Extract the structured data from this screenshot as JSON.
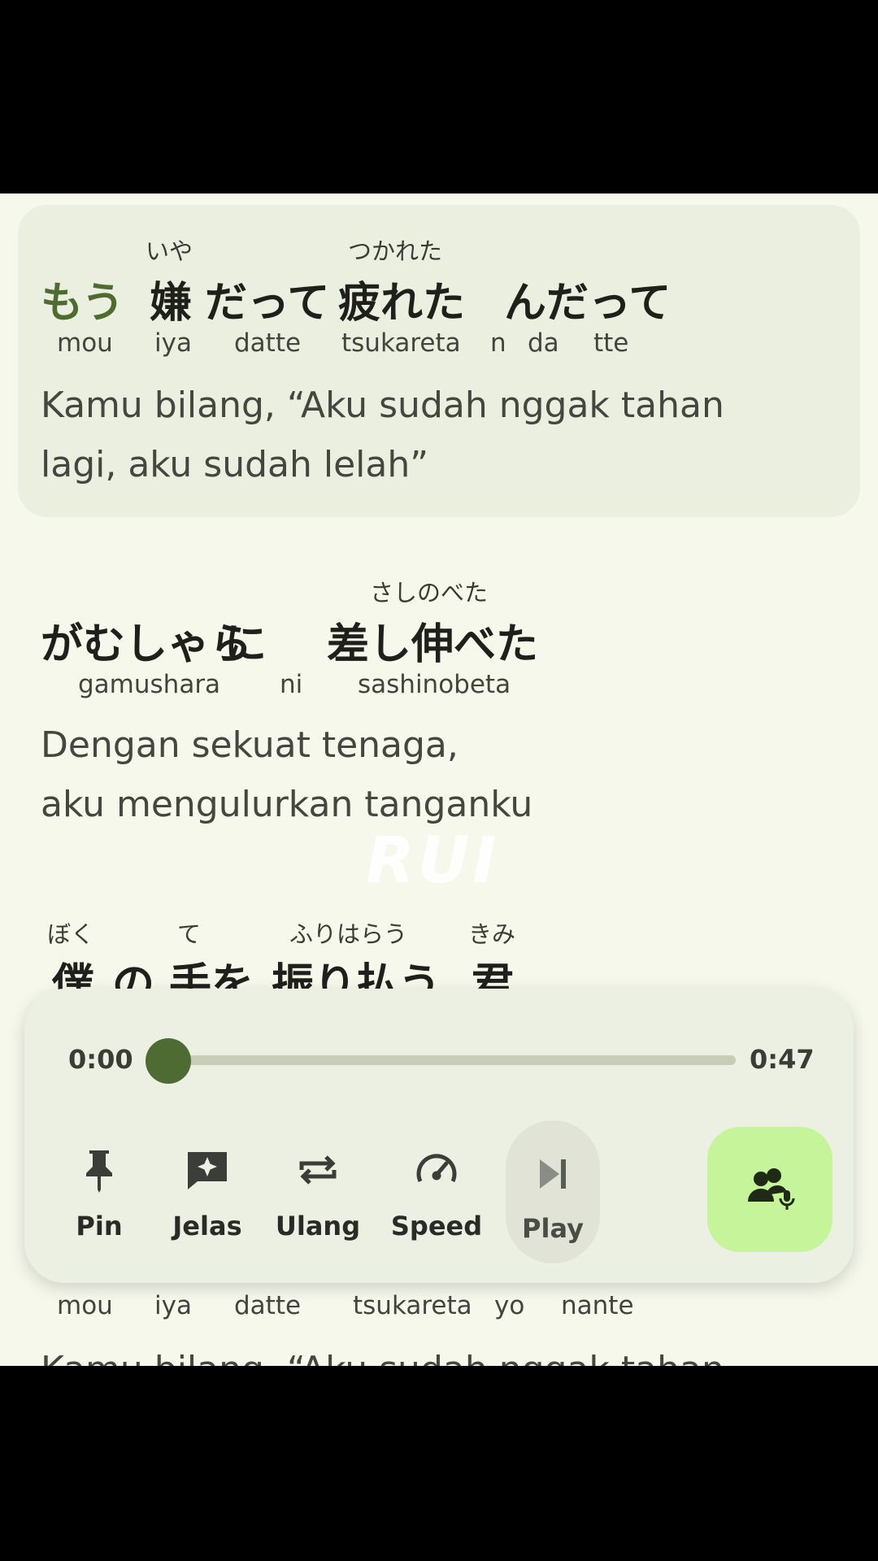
{
  "lyrics": {
    "block1": {
      "furigana": [
        "いや",
        "つかれた"
      ],
      "tokens": [
        "もう",
        "嫌",
        "だって",
        "疲れた",
        "ん",
        "だって"
      ],
      "romaji": [
        "mou",
        "iya",
        "datte",
        "tsukareta",
        "n",
        "da",
        "tte"
      ],
      "translation": [
        "Kamu bilang, “Aku sudah nggak tahan",
        "lagi, aku sudah lelah”"
      ]
    },
    "block2": {
      "furigana": [
        "さしのべた"
      ],
      "tokens": [
        "がむしゃら",
        "に",
        "差し伸べた"
      ],
      "romaji": [
        "gamushara",
        "ni",
        "sashinobeta"
      ],
      "translation": [
        "Dengan sekuat tenaga,",
        "aku mengulurkan tanganku"
      ]
    },
    "block3": {
      "furigana": [
        "ぼく",
        "て",
        "ふりはらう",
        "きみ"
      ],
      "tokens": [
        "僕",
        "の",
        "手を",
        "振り払う",
        "君"
      ]
    },
    "block4": {
      "romaji": [
        "mou",
        "iya",
        "datte",
        "tsukareta",
        "yo",
        "nante"
      ],
      "translation": [
        "Kamu bilang, “Aku sudah nggak tahan"
      ]
    }
  },
  "watermark": "RUI",
  "player": {
    "current_time": "0:00",
    "total_time": "0:47",
    "progress": 0.0,
    "controls": [
      {
        "icon": "pin-icon",
        "label": "Pin"
      },
      {
        "icon": "explain-icon",
        "label": "Jelas"
      },
      {
        "icon": "repeat-icon",
        "label": "Ulang"
      },
      {
        "icon": "speed-icon",
        "label": "Speed"
      },
      {
        "icon": "play-icon",
        "label": "Play"
      }
    ],
    "mic_button_icon": "voice-users-icon"
  },
  "colors": {
    "accent": "#4e6b32",
    "mic_button": "#c6f49a",
    "background": "#f6f8ec"
  }
}
